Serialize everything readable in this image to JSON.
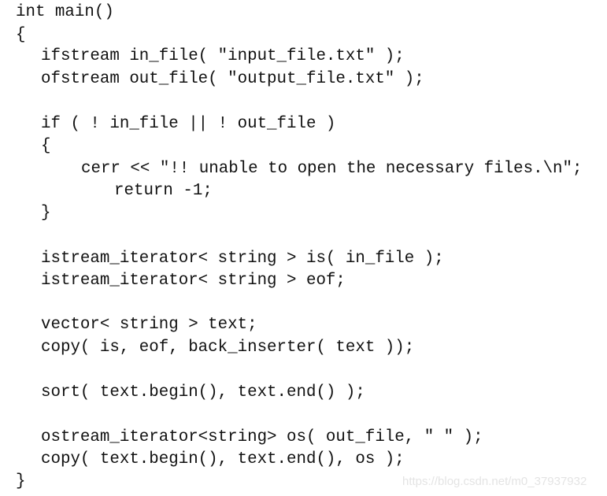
{
  "code_lines": [
    "int main()",
    "{",
    "ifstream in_file( \"input_file.txt\" );",
    "ofstream out_file( \"output_file.txt\" );",
    "if ( ! in_file || ! out_file )",
    "{",
    "cerr << \"!! unable to open the necessary files.\\n\";",
    "return -1;",
    "}",
    "istream_iterator< string > is( in_file );",
    "istream_iterator< string > eof;",
    "vector< string > text;",
    "copy( is, eof, back_inserter( text ));",
    "sort( text.begin(), text.end() );",
    "ostream_iterator<string> os( out_file, \" \" );",
    "copy( text.begin(), text.end(), os );",
    "}"
  ],
  "watermark": "https://blog.csdn.net/m0_37937932"
}
